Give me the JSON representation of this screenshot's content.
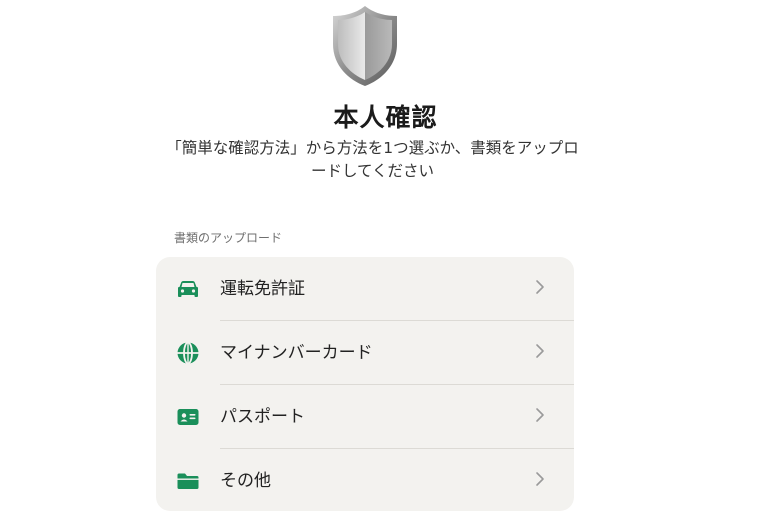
{
  "header": {
    "title": "本人確認",
    "subtitle": "「簡単な確認方法」から方法を1つ選ぶか、書類をアップロードしてください",
    "icon": "shield-icon"
  },
  "section": {
    "label": "書類のアップロード"
  },
  "documents": [
    {
      "label": "運転免許証",
      "icon": "car-icon"
    },
    {
      "label": "マイナンバーカード",
      "icon": "globe-icon"
    },
    {
      "label": "パスポート",
      "icon": "id-card-icon"
    },
    {
      "label": "その他",
      "icon": "folder-icon"
    }
  ],
  "colors": {
    "accent": "#1a8f5a",
    "card_background": "#f3f2ef",
    "chevron": "#9a9a9a"
  }
}
